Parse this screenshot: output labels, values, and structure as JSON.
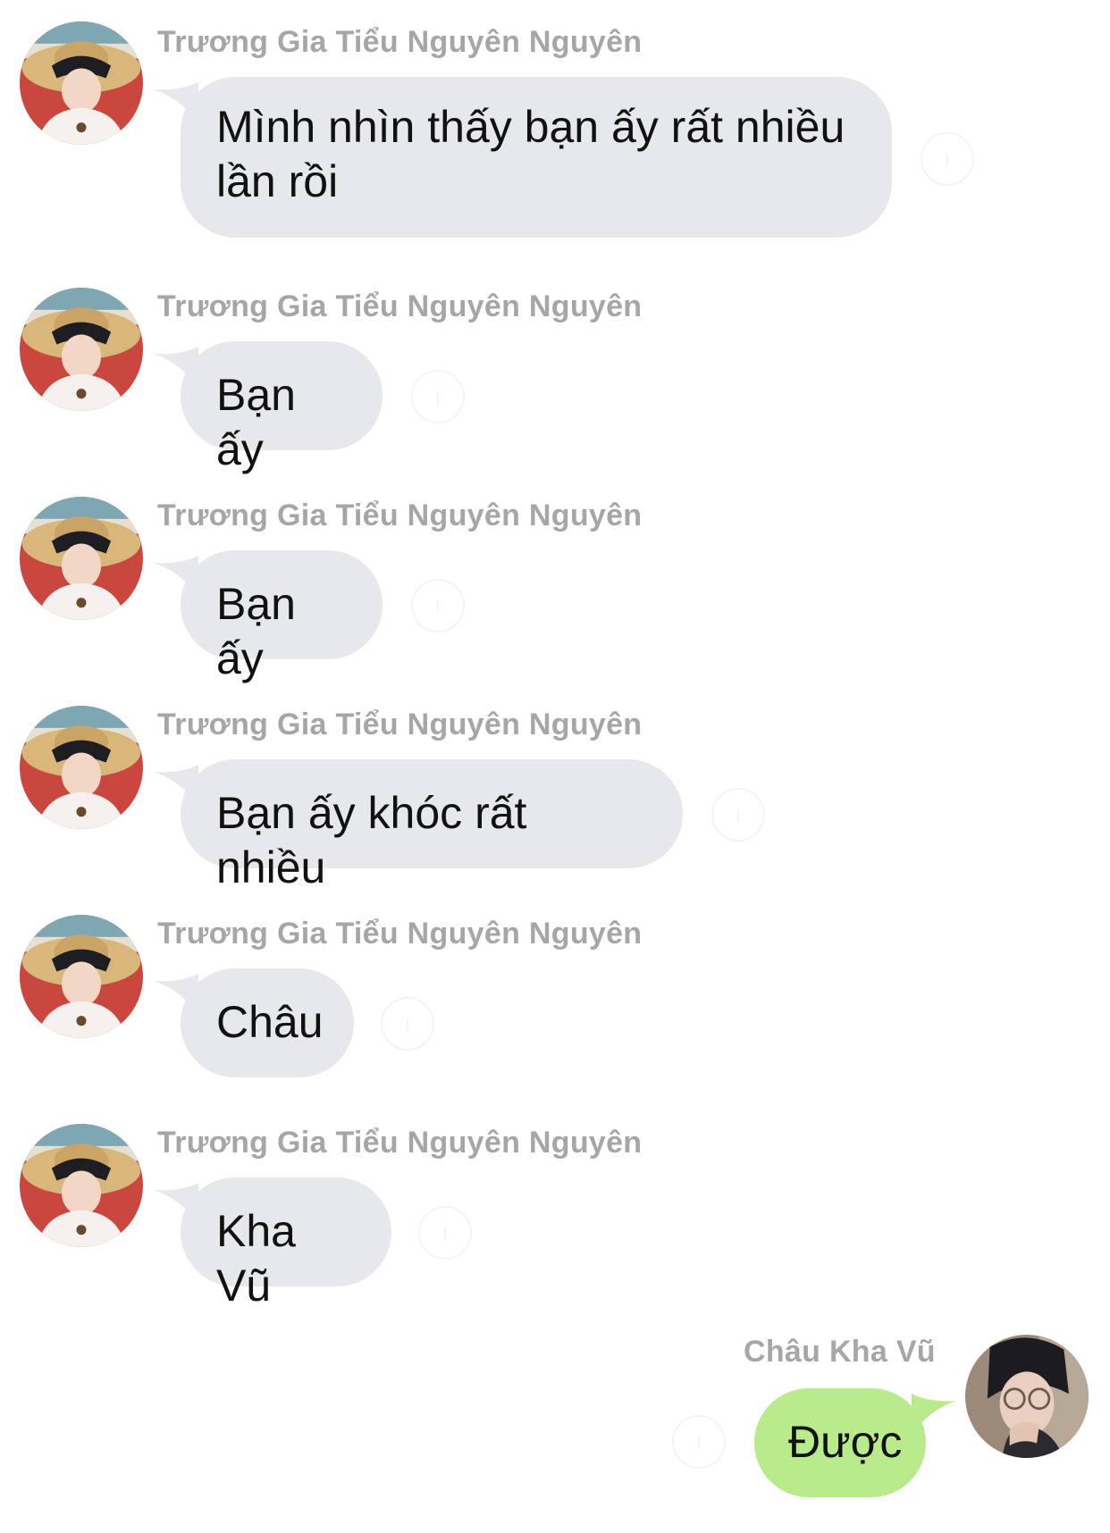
{
  "colors": {
    "incoming_bubble": "#e6e8ec",
    "outgoing_bubble": "#b9eb8d",
    "sender_name": "#a6a6a6",
    "message_text": "#111111",
    "background": "#ffffff"
  },
  "messages": [
    {
      "direction": "incoming",
      "sender": "Trương Gia Tiểu Nguyên Nguyên",
      "text": "Mình nhìn thấy bạn ấy rất nhiều lần rồi",
      "avatar_icon": "avatar-straw-hat-icon"
    },
    {
      "direction": "incoming",
      "sender": "Trương Gia Tiểu Nguyên Nguyên",
      "text": "Bạn ấy",
      "avatar_icon": "avatar-straw-hat-icon"
    },
    {
      "direction": "incoming",
      "sender": "Trương Gia Tiểu Nguyên Nguyên",
      "text": "Bạn ấy",
      "avatar_icon": "avatar-straw-hat-icon"
    },
    {
      "direction": "incoming",
      "sender": "Trương Gia Tiểu Nguyên Nguyên",
      "text": "Bạn ấy khóc rất nhiều",
      "avatar_icon": "avatar-straw-hat-icon"
    },
    {
      "direction": "incoming",
      "sender": "Trương Gia Tiểu Nguyên Nguyên",
      "text": "Châu",
      "avatar_icon": "avatar-straw-hat-icon"
    },
    {
      "direction": "incoming",
      "sender": "Trương Gia Tiểu Nguyên Nguyên",
      "text": "Kha Vũ",
      "avatar_icon": "avatar-straw-hat-icon"
    },
    {
      "direction": "outgoing",
      "sender": "Châu Kha Vũ",
      "text": "Được",
      "avatar_icon": "avatar-glasses-icon"
    }
  ]
}
